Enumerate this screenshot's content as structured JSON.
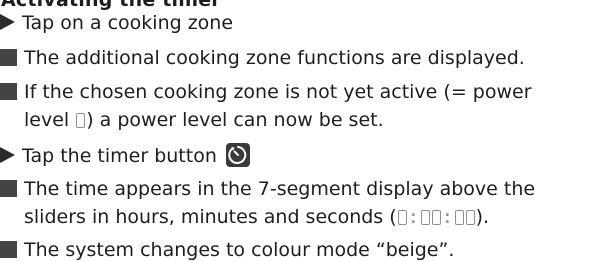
{
  "heading": "Activating the timer",
  "steps": [
    {
      "marker": "arrow",
      "text": "Tap on a cooking zone"
    },
    {
      "marker": "square",
      "text": "The additional cooking zone functions are displayed."
    },
    {
      "marker": "square",
      "text_line1": "If the chosen cooking zone is not yet active (= power",
      "text_line2_before": "level",
      "text_line2_after": ") a power level can now be set."
    },
    {
      "marker": "arrow",
      "text": "Tap the timer button"
    },
    {
      "marker": "square",
      "text_line1": "The time appears in the 7-segment display above the",
      "text_line2_before": "sliders in hours, minutes and seconds (",
      "text_line2_after": ")."
    },
    {
      "marker": "square",
      "text": "The system changes to colour mode “beige”."
    }
  ],
  "icons": {
    "timer": "timer-icon",
    "segment_zero": "seven-segment-zero-icon"
  },
  "colors": {
    "text": "#1d1d1d",
    "marker": "#444444",
    "segment": "#8f8f8f"
  }
}
